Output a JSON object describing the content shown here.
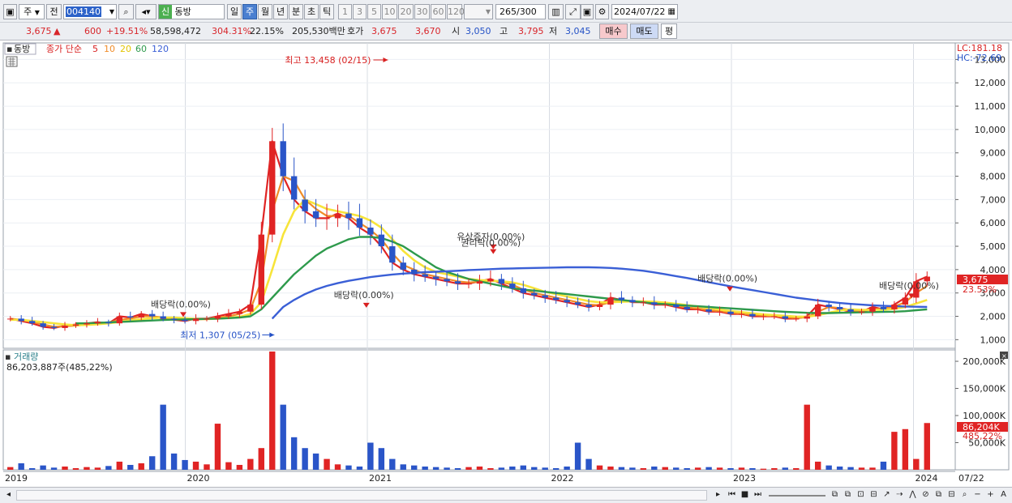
{
  "toolbar": {
    "market": "주",
    "prev": "전",
    "code": "004140",
    "badge": "신",
    "name": "동방",
    "periods": [
      "일",
      "주",
      "월",
      "년",
      "분",
      "초",
      "틱"
    ],
    "active_period": "주",
    "numbers": [
      "1",
      "3",
      "5",
      "10",
      "20",
      "30",
      "60",
      "120"
    ],
    "count": "265",
    "total": "/300",
    "date": "2024/07/22"
  },
  "quote": {
    "price": "3,675",
    "up_mark": "▲",
    "change": "600",
    "change_pct": "+19.51%",
    "volume": "58,598,472",
    "vol_ratio": "304.31%",
    "turnover": "22.15%",
    "amount": "205,530백만",
    "ask_label": "호가",
    "ask": "3,675",
    "bid": "3,670",
    "open_label": "시",
    "open": "3,050",
    "high_label": "고",
    "high": "3,795",
    "low_label": "저",
    "low": "3,045",
    "buy": "매수",
    "sell": "매도",
    "eval": "평"
  },
  "legend": {
    "name": "동방",
    "ma_label": "종가 단순",
    "ma_periods": [
      "5",
      "10",
      "20",
      "60",
      "120"
    ],
    "volume_label": "거래량",
    "volume_value": "86,203,887주(485,22%)"
  },
  "corner": {
    "lc": "LC:181.18",
    "hc": "HC:-72.69"
  },
  "price_badge": {
    "price": "3,675",
    "pct": "23.53%"
  },
  "volume_badge": {
    "value": "86,204K",
    "pct": "485,22%"
  },
  "colors": {
    "ma5": "#e02424",
    "ma10": "#f08c28",
    "ma20": "#f7e43a",
    "ma60": "#2e9a4c",
    "ma120": "#3a5fd6",
    "up": "#e02424",
    "down": "#2a55c8"
  },
  "chart_data": {
    "type": "candlestick",
    "frequency": "weekly",
    "x_labels": [
      "2019",
      "2020",
      "2021",
      "2022",
      "2023",
      "2024",
      "07/22"
    ],
    "y_ticks": [
      "1,000",
      "2,000",
      "3,000",
      "4,000",
      "5,000",
      "6,000",
      "7,000",
      "8,000",
      "9,000",
      "10,000",
      "11,000",
      "12,000",
      "13,000"
    ],
    "ylim": [
      700,
      13500
    ],
    "volume_ticks": [
      "50,000K",
      "100,000K",
      "150,000K",
      "200,000K"
    ],
    "volume_ylim": [
      0,
      215000
    ],
    "annotations": [
      {
        "text": "최고 13,458 (02/15)",
        "date": "2021-02-15",
        "value": 13458
      },
      {
        "text": "최저 1,307 (05/25)",
        "date": "2020-05-25",
        "value": 1307
      },
      {
        "text": "배당락(0.00%)",
        "date": "2019-12-27",
        "value": 1900
      },
      {
        "text": "배당락(0.00%)",
        "date": "2020-12-29",
        "value": 2300
      },
      {
        "text": "유상증자(0.00%)",
        "date": "2021-09-10",
        "value": 4800
      },
      {
        "text": "권리락(0.00%)",
        "date": "2021-09-10",
        "value": 4600
      },
      {
        "text": "배당락(0.00%)",
        "date": "2022-12-28",
        "value": 3000
      },
      {
        "text": "배당락(0.00%)",
        "date": "2023-12-27",
        "value": 2700
      }
    ],
    "series": [
      {
        "name": "5",
        "values": [
          1900,
          1800,
          1700,
          1550,
          1500,
          1600,
          1650,
          1700,
          1750,
          1700,
          2000,
          1950,
          2100,
          2000,
          1900,
          1850,
          1800,
          1900,
          1900,
          2000,
          2100,
          2200,
          2500,
          5500,
          9500,
          8000,
          7000,
          6500,
          6200,
          6200,
          6400,
          6200,
          5800,
          5500,
          5000,
          4300,
          4000,
          3800,
          3700,
          3600,
          3500,
          3400,
          3400,
          3500,
          3600,
          3400,
          3200,
          3000,
          2900,
          2800,
          2700,
          2600,
          2500,
          2400,
          2500,
          2800,
          2700,
          2600,
          2600,
          2500,
          2500,
          2400,
          2300,
          2300,
          2200,
          2200,
          2100,
          2100,
          2000,
          2000,
          2000,
          1900,
          1900,
          2000,
          2500,
          2400,
          2300,
          2200,
          2200,
          2400,
          2300,
          2500,
          2800,
          3500,
          3700
        ]
      },
      {
        "name": "10",
        "values": [
          1900,
          1850,
          1750,
          1650,
          1550,
          1580,
          1600,
          1650,
          1700,
          1720,
          1850,
          1900,
          2000,
          2000,
          1950,
          1900,
          1850,
          1870,
          1880,
          1950,
          2000,
          2100,
          2300,
          3500,
          6500,
          8000,
          7800,
          7000,
          6600,
          6300,
          6300,
          6300,
          6000,
          5700,
          5300,
          4700,
          4200,
          4000,
          3800,
          3700,
          3600,
          3500,
          3450,
          3480,
          3520,
          3480,
          3350,
          3150,
          3000,
          2900,
          2800,
          2700,
          2600,
          2500,
          2480,
          2600,
          2700,
          2650,
          2620,
          2560,
          2520,
          2450,
          2380,
          2330,
          2260,
          2220,
          2160,
          2110,
          2060,
          2030,
          2010,
          1960,
          1920,
          1960,
          2200,
          2400,
          2350,
          2270,
          2210,
          2300,
          2320,
          2420,
          2600,
          3000,
          3300
        ]
      },
      {
        "name": "20",
        "values": [
          1850,
          1850,
          1800,
          1750,
          1700,
          1650,
          1620,
          1630,
          1660,
          1700,
          1760,
          1820,
          1880,
          1920,
          1950,
          1950,
          1920,
          1890,
          1880,
          1900,
          1930,
          1980,
          2100,
          2600,
          4000,
          5500,
          6500,
          7000,
          6800,
          6600,
          6500,
          6400,
          6300,
          6100,
          5800,
          5300,
          4800,
          4400,
          4100,
          3900,
          3800,
          3700,
          3600,
          3550,
          3530,
          3500,
          3450,
          3350,
          3200,
          3050,
          2950,
          2850,
          2750,
          2650,
          2600,
          2600,
          2620,
          2640,
          2640,
          2620,
          2590,
          2540,
          2480,
          2420,
          2350,
          2290,
          2230,
          2180,
          2130,
          2080,
          2050,
          2020,
          1990,
          1980,
          2050,
          2150,
          2250,
          2300,
          2280,
          2280,
          2280,
          2320,
          2400,
          2550,
          2700
        ]
      },
      {
        "name": "60",
        "values": [
          null,
          null,
          null,
          null,
          null,
          null,
          1700,
          1700,
          1720,
          1740,
          1760,
          1780,
          1800,
          1820,
          1840,
          1860,
          1870,
          1880,
          1890,
          1900,
          1920,
          1950,
          2000,
          2300,
          2800,
          3300,
          3800,
          4200,
          4600,
          4900,
          5100,
          5300,
          5400,
          5400,
          5350,
          5200,
          5000,
          4700,
          4400,
          4100,
          3900,
          3750,
          3600,
          3500,
          3400,
          3300,
          3200,
          3150,
          3100,
          3050,
          3000,
          2950,
          2900,
          2850,
          2800,
          2750,
          2700,
          2650,
          2600,
          2550,
          2520,
          2490,
          2460,
          2430,
          2400,
          2370,
          2340,
          2310,
          2280,
          2250,
          2220,
          2190,
          2170,
          2150,
          2140,
          2140,
          2150,
          2160,
          2170,
          2180,
          2190,
          2200,
          2220,
          2260,
          2300
        ]
      },
      {
        "name": "120",
        "values": [
          null,
          null,
          null,
          null,
          null,
          null,
          null,
          null,
          null,
          null,
          null,
          null,
          null,
          null,
          null,
          null,
          null,
          null,
          null,
          null,
          null,
          null,
          null,
          null,
          1900,
          2400,
          2700,
          2950,
          3150,
          3300,
          3420,
          3520,
          3600,
          3680,
          3740,
          3790,
          3830,
          3860,
          3890,
          3910,
          3930,
          3950,
          3980,
          4000,
          4020,
          4040,
          4050,
          4060,
          4070,
          4080,
          4090,
          4100,
          4100,
          4100,
          4090,
          4070,
          4040,
          4000,
          3950,
          3880,
          3800,
          3720,
          3640,
          3550,
          3460,
          3370,
          3280,
          3200,
          3120,
          3040,
          2960,
          2880,
          2800,
          2740,
          2680,
          2620,
          2570,
          2530,
          2500,
          2470,
          2450,
          2430,
          2420,
          2410,
          2400
        ]
      }
    ],
    "volume": [
      5000,
      12000,
      3000,
      8000,
      4000,
      6000,
      3000,
      5000,
      4000,
      7000,
      15000,
      9000,
      12000,
      25000,
      120000,
      30000,
      18000,
      15000,
      10000,
      85000,
      14000,
      9000,
      20000,
      40000,
      218000,
      120000,
      60000,
      40000,
      30000,
      20000,
      10000,
      8000,
      6000,
      50000,
      40000,
      20000,
      10000,
      8000,
      6000,
      5000,
      4000,
      3000,
      5000,
      6000,
      3000,
      4000,
      6000,
      8000,
      5000,
      4000,
      3000,
      6000,
      50000,
      20000,
      8000,
      6000,
      5000,
      4000,
      3000,
      6000,
      5000,
      4000,
      3000,
      4000,
      5000,
      4000,
      3000,
      4000,
      3000,
      2000,
      3000,
      4000,
      3000,
      120000,
      15000,
      8000,
      6000,
      5000,
      4000,
      4000,
      15000,
      70000,
      75000,
      20000,
      86204
    ]
  }
}
